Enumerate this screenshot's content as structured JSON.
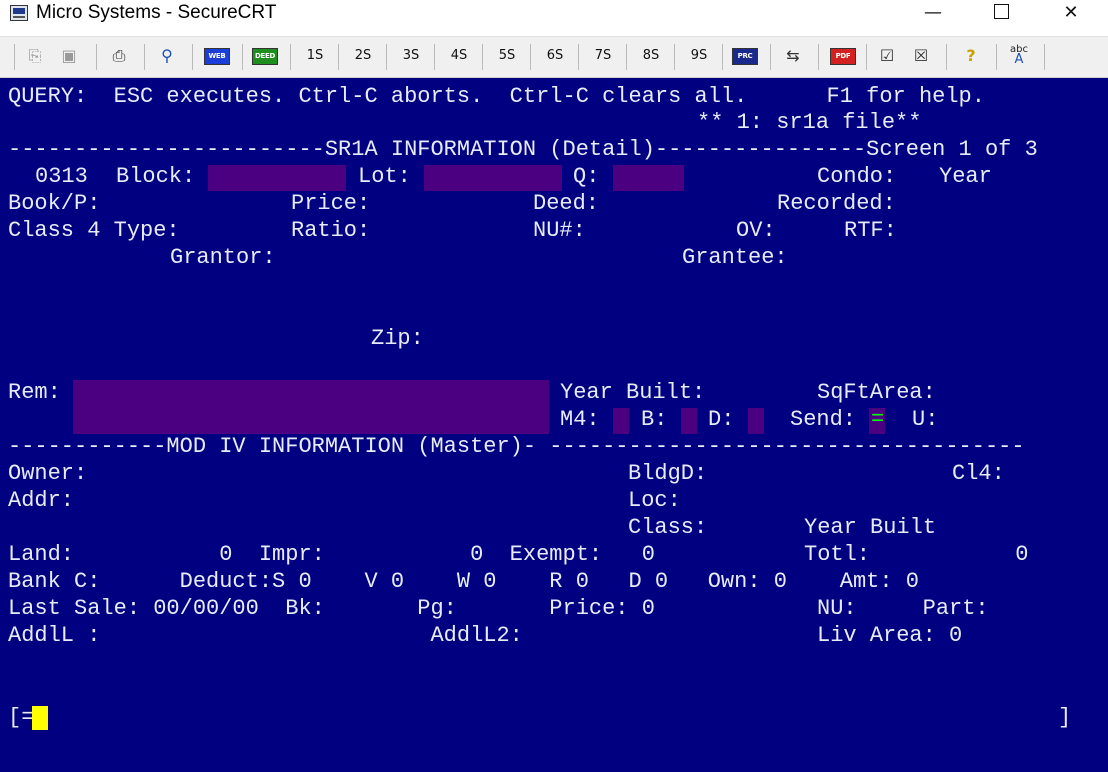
{
  "window": {
    "title": "Micro Systems - SecureCRT",
    "minimize_glyph": "—",
    "close_glyph": "✕"
  },
  "toolbar": {
    "session_buttons": [
      "1S",
      "2S",
      "3S",
      "4S",
      "5S",
      "6S",
      "7S",
      "8S",
      "9S"
    ],
    "badges": {
      "web": "WEB",
      "deed": "DEED",
      "prc": "PRC",
      "pdf": "PDF",
      "abc": "abc"
    },
    "colors": {
      "web": "#1b3fd6",
      "deed": "#1e8f1e",
      "prc": "#1a2a8c",
      "pdf": "#d32020"
    }
  },
  "terminal": {
    "colors": {
      "background": "#000080",
      "text": "#e8ecf8",
      "highlight": "#4b0082",
      "cursor": "#ffff00",
      "send_mark": "#00ff00"
    },
    "lines": {
      "query": "QUERY:  ESC executes. Ctrl-C aborts.  Ctrl-C clears all.      F1 for help.",
      "file": "** 1: sr1a file**",
      "sr1a_header": "------------------------SR1A INFORMATION (Detail)----------------Screen 1 of 3",
      "block_id": "0313",
      "block_label": "Block:",
      "lot_label": "Lot:",
      "q_label": "Q:",
      "condo_label": "Condo:",
      "year_label": "Year",
      "book_label": "Book/P:",
      "price_label": "Price:",
      "deed_label": "Deed:",
      "recorded_label": "Recorded:",
      "class4_label": "Class 4 Type:",
      "ratio_label": "Ratio:",
      "nu_label": "NU#:",
      "ov_label": "OV:",
      "rtf_label": "RTF:",
      "grantor_label": "Grantor:",
      "grantee_label": "Grantee:",
      "zip_label": "Zip:",
      "rem_label": "Rem:",
      "year_built_label": "Year Built:",
      "sqft_label": "SqFtArea:",
      "m4_label": "M4:",
      "b_label": "B:",
      "d_label": "D:",
      "send_label": "Send:",
      "send_value": "=",
      "u_label": "U:",
      "mod_header": "------------MOD IV INFORMATION (Master)- ------------------------------------",
      "owner_label": "Owner:",
      "bldgd_label": "BldgD:",
      "cl4_label": "Cl4:",
      "addr_label": "Addr:",
      "loc_label": "Loc:",
      "class_label": "Class:",
      "year_built2_label": "Year Built",
      "land_row": "Land:           0  Impr:           0  Exempt:   0",
      "totl_row": "Totl:           0",
      "bank_row": "Bank C:      Deduct:S 0    V 0    W 0    R 0   D 0   Own: 0    Amt: 0",
      "last_sale_row": "Last Sale: 00/00/00  Bk:       Pg:       Price: 0",
      "nu_part_row": "NU:     Part:",
      "addl_row": "AddlL :                         AddlL2:",
      "liv_row": "Liv Area: 0",
      "prompt_left": "[=",
      "prompt_right": "]"
    }
  }
}
